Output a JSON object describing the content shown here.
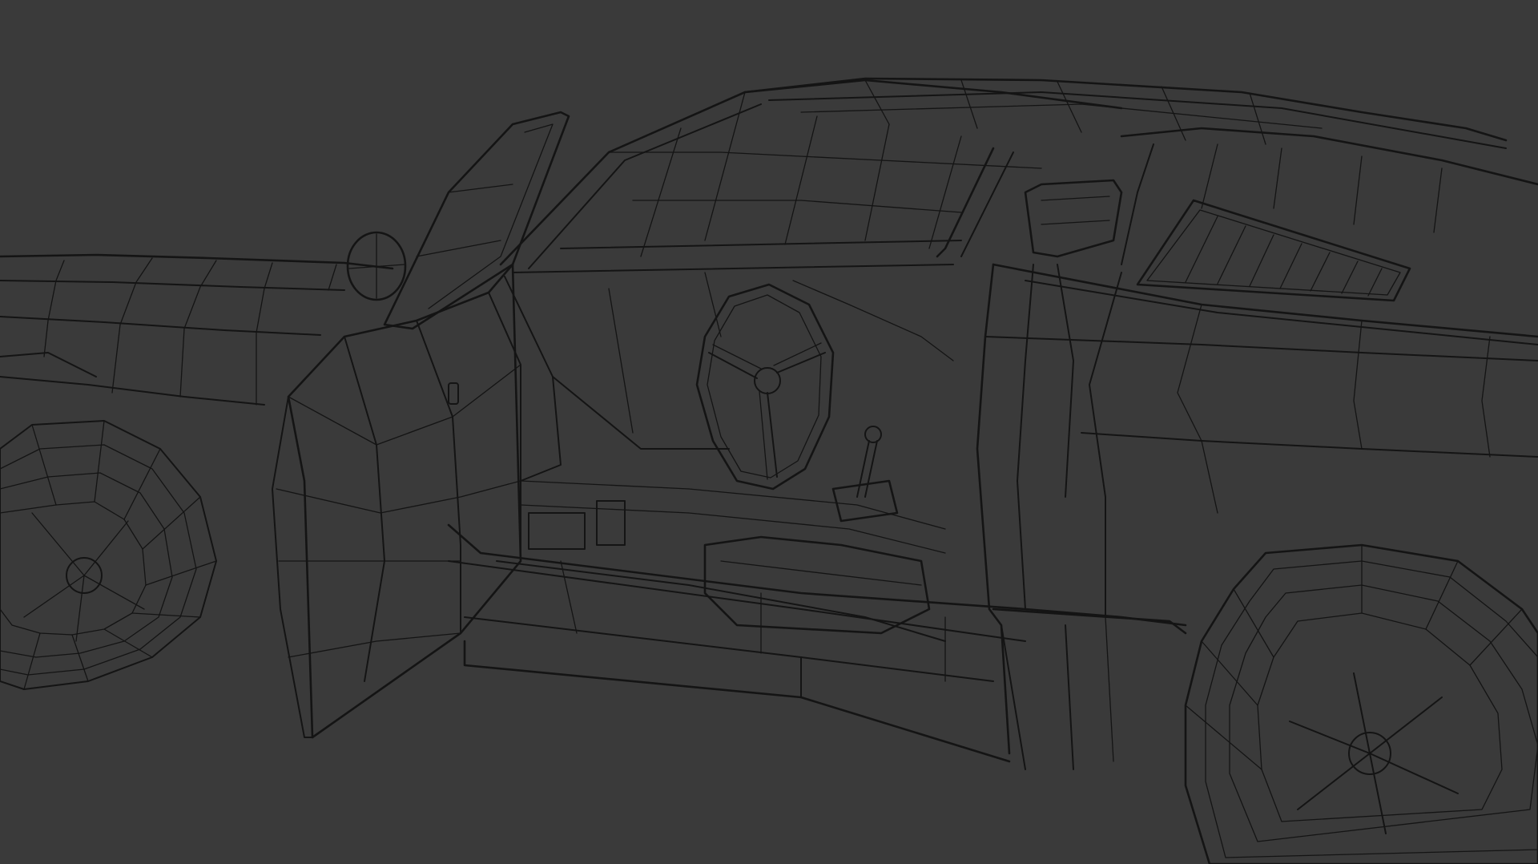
{
  "viewport": {
    "background_color": "#3a3a3a",
    "wire_color": "#141414",
    "shading_mode": "wireframe"
  },
  "model": {
    "object": "car",
    "parts": [
      "body",
      "open-driver-door",
      "windshield",
      "roof",
      "side-mirror",
      "steering-wheel",
      "gear-shifter",
      "seat",
      "rear-side-window",
      "front-wheel",
      "rear-wheel"
    ]
  }
}
